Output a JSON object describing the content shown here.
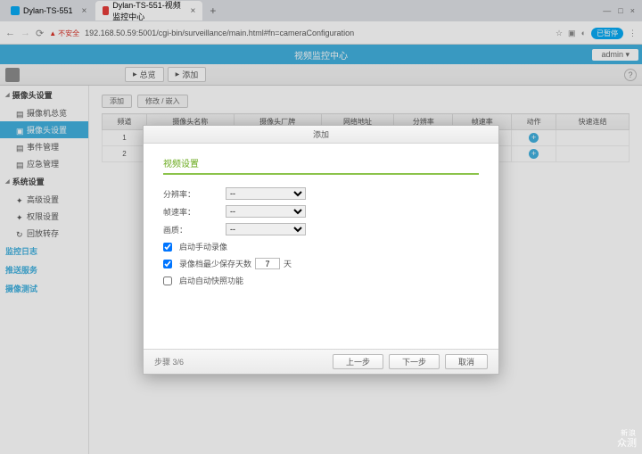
{
  "browser": {
    "tabs": [
      {
        "label": "Dylan-TS-551",
        "active": false
      },
      {
        "label": "Dylan-TS-551-视频监控中心",
        "active": true
      }
    ],
    "security_label": "不安全",
    "url": "192.168.50.59:5001/cgi-bin/surveillance/main.html#fn=cameraConfiguration",
    "ext_badge": "已暂停"
  },
  "app": {
    "title": "视频监控中心",
    "user": "admin ▾",
    "toolbar": {
      "btn1": "总览",
      "btn2": "添加"
    }
  },
  "sidebar": {
    "group1": "摄像头设置",
    "items1": [
      "摄像机总览",
      "摄像头设置",
      "事件管理",
      "应急管理"
    ],
    "group2": "系统设置",
    "items2": [
      "高级设置",
      "权限设置",
      "回放转存"
    ],
    "links": [
      "监控日志",
      "推送服务",
      "摄像测试"
    ]
  },
  "content": {
    "btn_add": "添加",
    "btn_edit": "修改 / 嵌入",
    "columns": [
      "频道",
      "摄像头名称",
      "摄像头厂牌",
      "网络地址",
      "分辨率",
      "帧速率",
      "动作",
      "快速连结"
    ],
    "rows": [
      {
        "ch": "1",
        "name": "--",
        "brand": "--",
        "addr": "--",
        "res": "--",
        "fps": "--"
      },
      {
        "ch": "2",
        "name": "--",
        "brand": "--",
        "addr": "--",
        "res": "--",
        "fps": "--"
      }
    ]
  },
  "modal": {
    "title": "添加",
    "section": "视频设置",
    "label_res": "分辨率：",
    "label_fps": "帧速率：",
    "label_quality": "画质：",
    "opt_empty": "--",
    "cb_manual": "启动手动录像",
    "cb_retain_prefix": "录像档最少保存天数",
    "retain_days": "7",
    "retain_suffix": "天",
    "cb_snapshot": "启动自动快照功能",
    "step": "步骤 3/6",
    "prev": "上一步",
    "next": "下一步",
    "cancel": "取消"
  },
  "watermark": {
    "line1": "新浪",
    "line2": "众测"
  }
}
